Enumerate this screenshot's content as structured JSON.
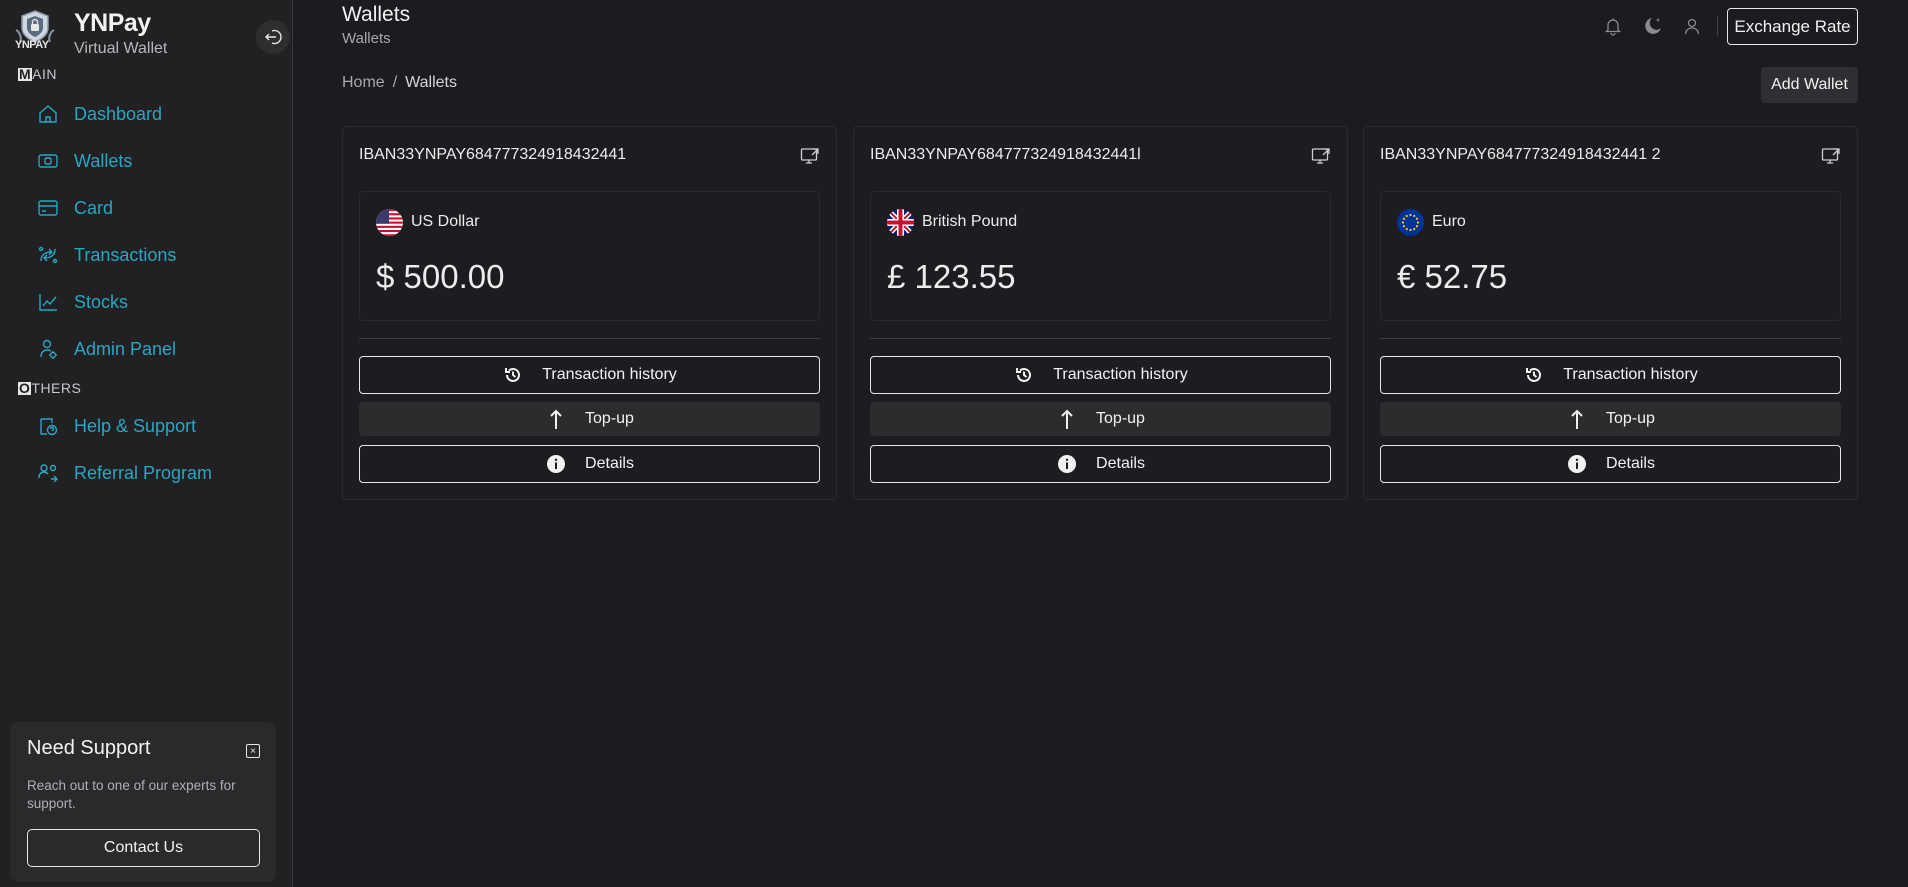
{
  "sidebar": {
    "brand_name": "YNPay",
    "brand_sub": "Virtual Wallet",
    "logo_text": "YNPAY",
    "sections": {
      "main_first": "M",
      "main_rest": "AIN",
      "others_first": "O",
      "others_rest": "THERS"
    },
    "items": [
      {
        "label": "Dashboard",
        "icon": "home-icon"
      },
      {
        "label": "Wallets",
        "icon": "wallet-icon"
      },
      {
        "label": "Card",
        "icon": "card-icon"
      },
      {
        "label": "Transactions",
        "icon": "transactions-icon"
      },
      {
        "label": "Stocks",
        "icon": "chart-icon"
      },
      {
        "label": "Admin Panel",
        "icon": "admin-icon"
      },
      {
        "label": "Help & Support",
        "icon": "help-icon"
      },
      {
        "label": "Referral Program",
        "icon": "referral-icon"
      }
    ],
    "support": {
      "title": "Need Support",
      "text": "Reach out to one of our experts for support.",
      "button": "Contact Us"
    }
  },
  "header": {
    "title": "Wallets",
    "subtitle": "Wallets",
    "exchange_button": "Exchange Rate",
    "icons": [
      "bell-icon",
      "moon-icon",
      "user-icon"
    ]
  },
  "breadcrumb": {
    "home": "Home",
    "separator": "/",
    "current": "Wallets"
  },
  "add_wallet_button": "Add Wallet",
  "wallets": [
    {
      "iban": "IBAN33YNPAY684777324918432441",
      "currency": "US Dollar",
      "balance": "$ 500.00",
      "flag": "us-flag-icon",
      "buttons": {
        "history": "Transaction history",
        "topup": "Top-up",
        "details": "Details"
      }
    },
    {
      "iban": "IBAN33YNPAY684777324918432441l",
      "currency": "British Pound",
      "balance": "£ 123.55",
      "flag": "uk-flag-icon",
      "buttons": {
        "history": "Transaction history",
        "topup": "Top-up",
        "details": "Details"
      }
    },
    {
      "iban": "IBAN33YNPAY684777324918432441 2",
      "currency": "Euro",
      "balance": "€ 52.75",
      "flag": "eu-flag-icon",
      "buttons": {
        "history": "Transaction history",
        "topup": "Top-up",
        "details": "Details"
      }
    }
  ],
  "colors": {
    "accent": "#2aa6c2",
    "background": "#1b1b20",
    "sidebar": "#212123"
  }
}
